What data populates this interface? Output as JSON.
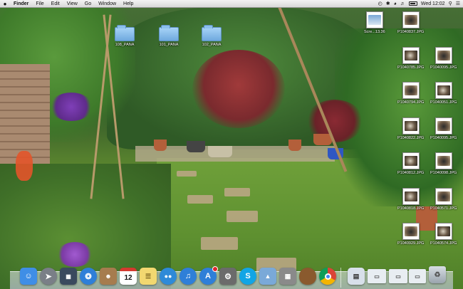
{
  "menubar": {
    "app_name": "Finder",
    "items": [
      "File",
      "Edit",
      "View",
      "Go",
      "Window",
      "Help"
    ],
    "clock": "Wed 12:02"
  },
  "desktop": {
    "folders": [
      {
        "label": "108_PANA"
      },
      {
        "label": "101_PANA"
      },
      {
        "label": "102_PANA"
      }
    ],
    "screenshot_label": "Scre...13.36",
    "images": [
      "P1040837.JPG",
      "P1040785.JPG",
      "P1040095.JPG",
      "P1040794.JPG",
      "P1040051.JPG",
      "P1040822.JPG",
      "P1040095.JPG",
      "P1040812.JPG",
      "P1040098.JPG",
      "P1040818.JPG",
      "P1040571.JPG",
      "P1040929.JPG",
      "P1040574.JPG"
    ]
  },
  "dock": {
    "icons": [
      {
        "icon": "finder-icon",
        "color": "#3f8ee6"
      },
      {
        "icon": "launchpad-icon",
        "color": "#7a7f87"
      },
      {
        "icon": "mission-control-icon",
        "color": "#3a4a5e"
      },
      {
        "icon": "safari-icon",
        "color": "#2f7fd8"
      },
      {
        "icon": "contacts-icon",
        "color": "#a67c4e"
      },
      {
        "icon": "calendar-icon",
        "color": "#ffffff",
        "text": "12"
      },
      {
        "icon": "notes-icon",
        "color": "#f2d870"
      },
      {
        "icon": "messages-icon",
        "color": "#2e8ad8"
      },
      {
        "icon": "itunes-icon",
        "color": "#2f7fd8"
      },
      {
        "icon": "app-store-icon",
        "color": "#2f7fd8"
      },
      {
        "icon": "system-preferences-icon",
        "color": "#6b6b6b"
      },
      {
        "icon": "skype-icon",
        "color": "#12a5e5",
        "text": "S"
      },
      {
        "icon": "preview-icon",
        "color": "#7aa9d8"
      },
      {
        "icon": "calculator-icon",
        "color": "#8a8a8a"
      },
      {
        "icon": "egg-app-icon",
        "color": "#8a5a2e"
      },
      {
        "icon": "chrome-icon",
        "color": "#ffffff"
      },
      {
        "icon": "document-stack-icon",
        "color": "#d8e0ea"
      },
      {
        "icon": "window-thumbnail-icon",
        "color": "#e8edf2"
      },
      {
        "icon": "window-thumbnail-icon",
        "color": "#e8edf2"
      },
      {
        "icon": "window-thumbnail-icon",
        "color": "#e8edf2"
      },
      {
        "icon": "trash-icon",
        "color": "#b9c2cb"
      }
    ]
  }
}
